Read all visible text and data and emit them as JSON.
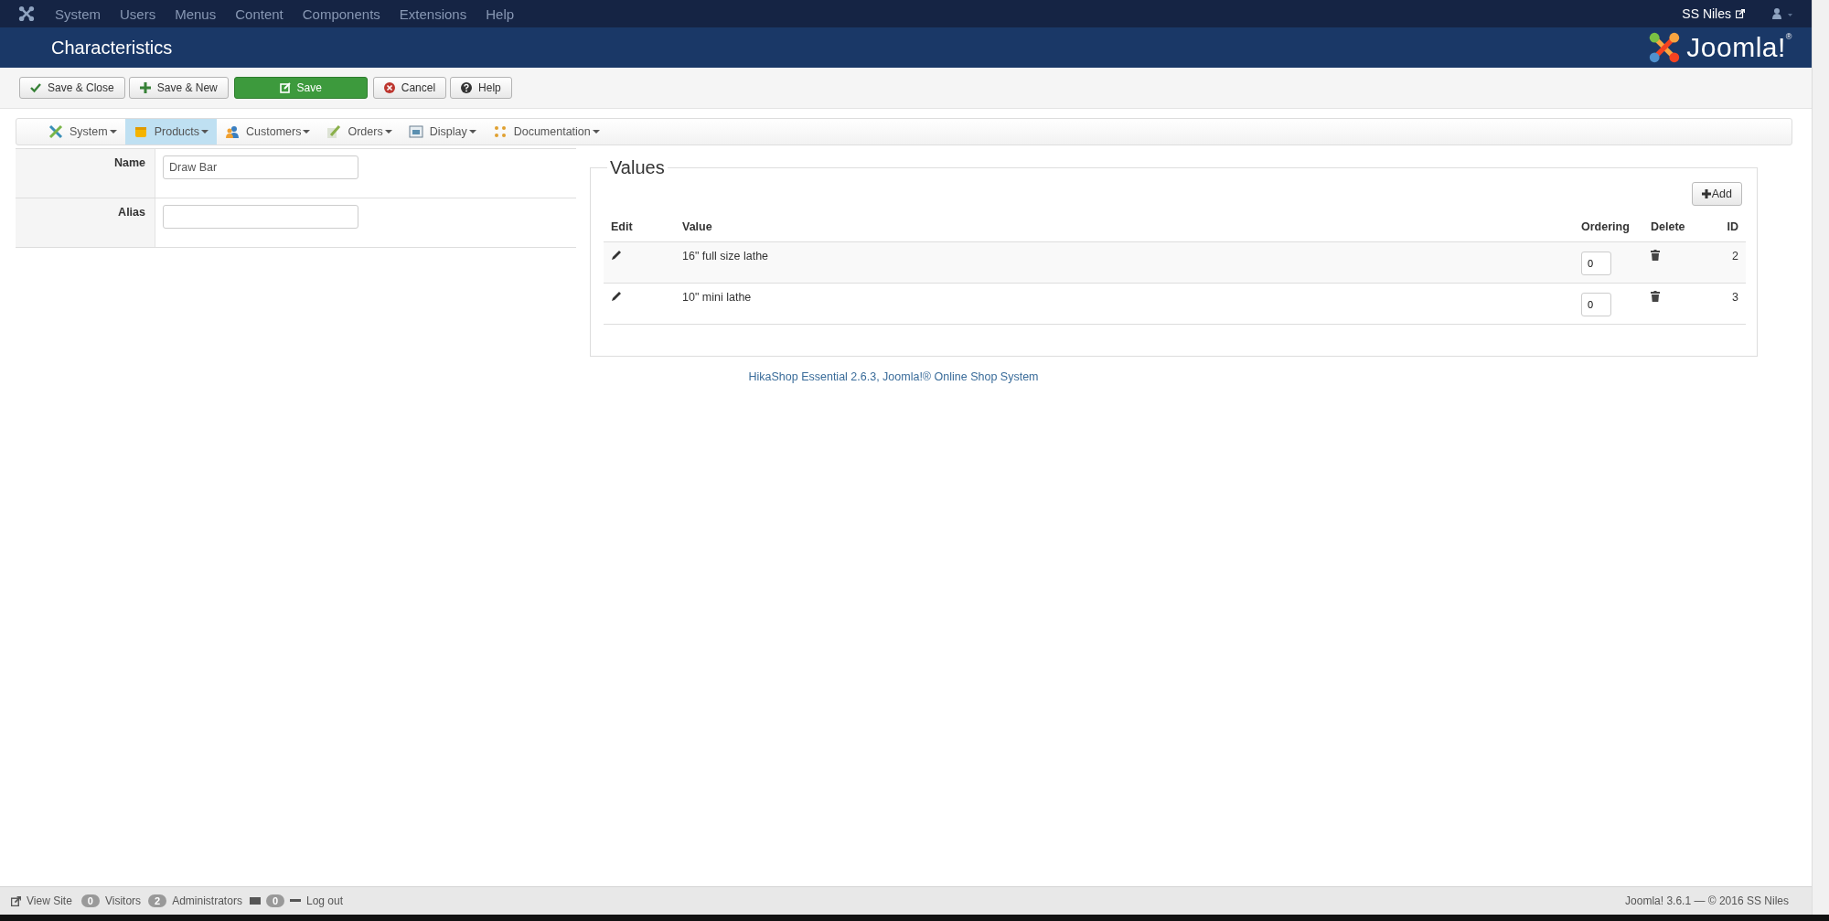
{
  "top_menu": [
    "System",
    "Users",
    "Menus",
    "Content",
    "Components",
    "Extensions",
    "Help"
  ],
  "user": {
    "name": "SS Niles"
  },
  "header": {
    "title": "Characteristics",
    "logo_text": "Joomla!$^{®}$"
  },
  "toolbar": [
    {
      "label": "Save & Close",
      "kind": "check",
      "primary": false
    },
    {
      "label": "Save & New",
      "kind": "plus",
      "primary": false
    },
    {
      "label": "Save",
      "kind": "edit",
      "primary": true
    },
    {
      "label": "Cancel",
      "kind": "cancel",
      "primary": false
    },
    {
      "label": "Help",
      "kind": "help",
      "primary": false
    }
  ],
  "submenu": [
    {
      "label": "System",
      "kind": "tools",
      "selected": false
    },
    {
      "label": "Products",
      "kind": "box",
      "selected": true
    },
    {
      "label": "Customers",
      "kind": "people",
      "selected": false
    },
    {
      "label": "Orders",
      "kind": "pen",
      "selected": false
    },
    {
      "label": "Display",
      "kind": "screen",
      "selected": false
    },
    {
      "label": "Documentation",
      "kind": "dots",
      "selected": false
    }
  ],
  "form": [
    {
      "label": "Name",
      "value": "Draw Bar"
    },
    {
      "label": "Alias"
    }
  ],
  "values": {
    "legend": "Values",
    "add_button": "Add",
    "columns": [
      "Edit",
      "Value",
      "Ordering",
      "Delete",
      "ID"
    ],
    "rows": [
      {
        "value": "16\" full size lathe",
        "ordering": "0",
        "id": "2"
      },
      {
        "value": "10\" mini lathe",
        "ordering": "0",
        "id": "3"
      }
    ]
  },
  "footer_link": "HikaShop Essential 2.6.3, Joomla!® Online Shop System",
  "status_bar": {
    "view_site": "View Site",
    "visitors_count": "0",
    "visitors": "Visitors",
    "admins_count": "2",
    "admins": "Administrators",
    "messages_count": "0",
    "logout": "Log out",
    "version": "Joomla! 3.6.1 — © 2016 SS Niles"
  }
}
